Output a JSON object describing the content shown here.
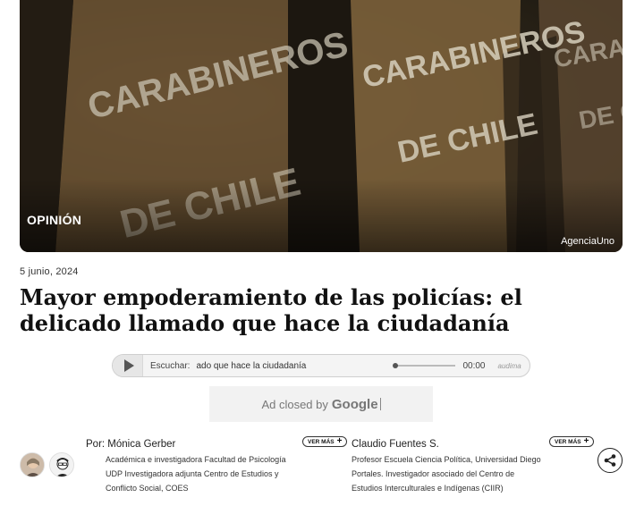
{
  "hero": {
    "tag": "OPINIÓN",
    "credit": "AgenciaUno",
    "photo_text": [
      "CARABINEROS",
      "DE CHILE"
    ]
  },
  "article": {
    "date": "5 junio, 2024",
    "title": "Mayor empoderamiento de las policías: el delicado llamado que hace la ciudadanía"
  },
  "audio_player": {
    "label": "Escuchar:",
    "title_scroll": "ado que hace la ciudadanía",
    "time": "00:00",
    "brand": "audima",
    "progress": 0
  },
  "ad": {
    "text": "Ad closed by",
    "brand": "Google"
  },
  "byline": {
    "prefix": "Por:",
    "authors": [
      {
        "name": "Mónica Gerber",
        "description": "Académica e investigadora Facultad de Psicología UDP Investigadora adjunta Centro de Estudios y Conflicto Social, COES",
        "more_label": "VER MÁS"
      },
      {
        "name": "Claudio Fuentes S.",
        "description": "Profesor Escuela Ciencia Política, Universidad Diego Portales. Investigador asociado del Centro de Estudios Interculturales e Indígenas (CIIR)",
        "more_label": "VER MÁS"
      }
    ]
  },
  "icons": {
    "play": "play-icon",
    "share": "share-icon",
    "plus": "plus-icon"
  }
}
